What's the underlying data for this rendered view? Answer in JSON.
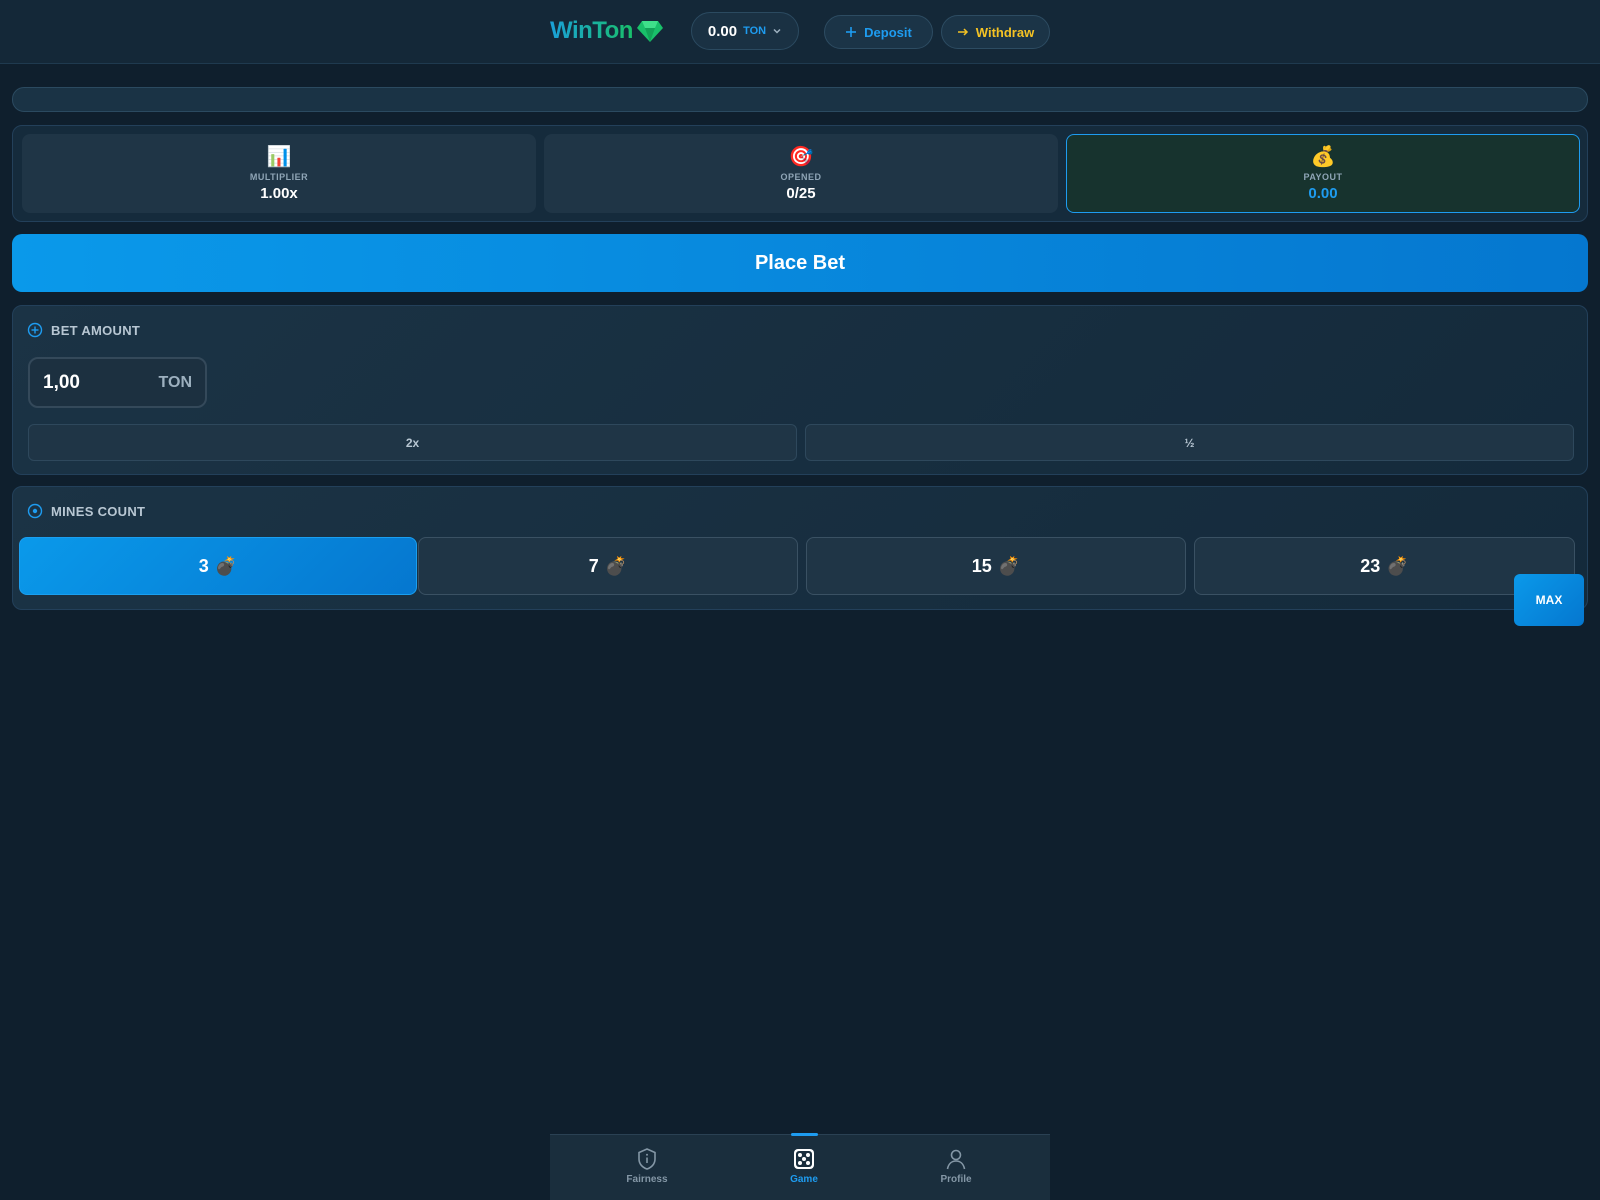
{
  "header": {
    "logo_text": "WinTon",
    "balance": {
      "amount": "0.00",
      "currency": "TON"
    },
    "deposit_label": "Deposit",
    "withdraw_label": "Withdraw"
  },
  "progress": {
    "fraction": 0
  },
  "stats": [
    {
      "icon": "📊",
      "icon_name": "bar-chart-icon",
      "label": "MULTIPLIER",
      "value": "1.00x"
    },
    {
      "icon": "🎯",
      "icon_name": "target-icon",
      "label": "OPENED",
      "value": "0/25"
    },
    {
      "icon": "💰",
      "icon_name": "money-bag-icon",
      "label": "PAYOUT",
      "value": "0.00"
    }
  ],
  "place_bet_label": "Place Bet",
  "bet_amount": {
    "title": "BET AMOUNT",
    "value": "1,00",
    "currency": "TON",
    "double_label": "2x",
    "half_label": "½"
  },
  "mines": {
    "title": "MINES COUNT",
    "bomb": "💣",
    "options": [
      "3",
      "7",
      "15",
      "23"
    ],
    "selected": "3",
    "max_label": "MAX"
  },
  "nav": {
    "items": [
      {
        "label": "Fairness",
        "icon_name": "shield-info-icon"
      },
      {
        "label": "Game",
        "icon_name": "dice-icon"
      },
      {
        "label": "Profile",
        "icon_name": "user-icon"
      }
    ],
    "active": "Game"
  },
  "colors": {
    "accent": "#1e9cf0",
    "withdraw": "#f5c324",
    "background": "#0f1f2d",
    "gem": "#19c06a"
  }
}
